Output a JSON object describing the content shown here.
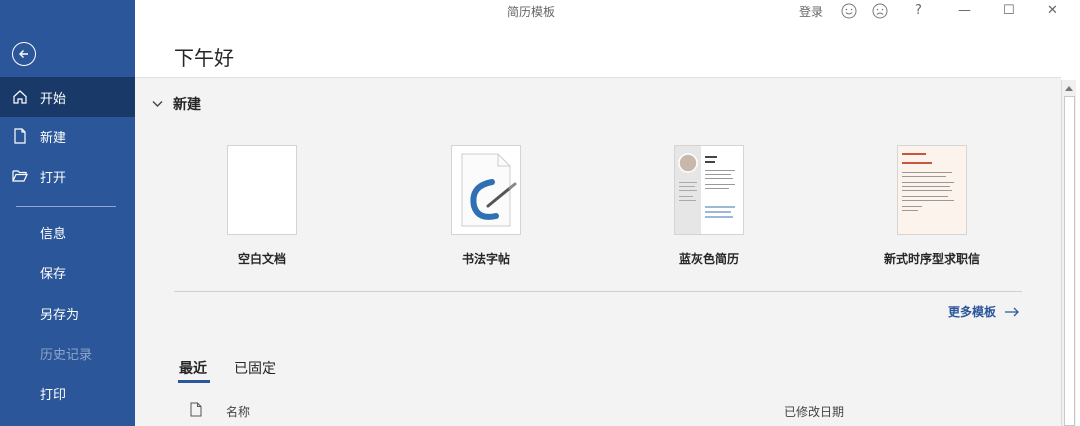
{
  "window": {
    "title": "简历模板",
    "login_label": "登录",
    "help_label": "?",
    "minimize_label": "—",
    "maximize_label": "☐",
    "close_label": "✕"
  },
  "sidebar": {
    "items": [
      {
        "label": "开始",
        "icon": "home-icon"
      },
      {
        "label": "新建",
        "icon": "new-doc-icon"
      },
      {
        "label": "打开",
        "icon": "folder-open-icon"
      },
      {
        "label": "信息"
      },
      {
        "label": "保存"
      },
      {
        "label": "另存为"
      },
      {
        "label": "历史记录"
      },
      {
        "label": "打印"
      }
    ]
  },
  "main": {
    "greeting": "下午好",
    "new_section": {
      "title": "新建",
      "templates": [
        {
          "label": "空白文档"
        },
        {
          "label": "书法字帖"
        },
        {
          "label": "蓝灰色简历"
        },
        {
          "label": "新式时序型求职信"
        }
      ],
      "more_label": "更多模板"
    },
    "tabs": [
      {
        "label": "最近"
      },
      {
        "label": "已固定"
      }
    ],
    "columns": {
      "name": "名称",
      "modified": "已修改日期"
    }
  },
  "colors": {
    "sidebar_bg": "#2b579a",
    "sidebar_active": "#193a69",
    "accent": "#2b579a",
    "panel_bg": "#f3f3f3"
  }
}
